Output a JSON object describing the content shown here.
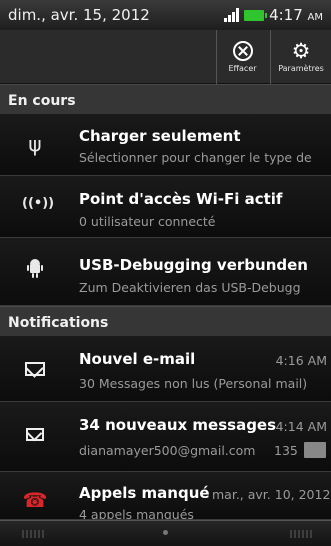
{
  "status_bar": {
    "date": "dim., avr. 15, 2012",
    "time": "4:17",
    "ampm": "AM"
  },
  "toolbar": {
    "clear_label": "Effacer",
    "settings_label": "Paramètres"
  },
  "sections": {
    "ongoing": "En cours",
    "notifications": "Notifications"
  },
  "ongoing": [
    {
      "icon": "usb-icon",
      "title": "Charger seulement",
      "subtitle": "Sélectionner pour changer le type de"
    },
    {
      "icon": "wifi-hotspot-icon",
      "title": "Point d'accès Wi-Fi actif",
      "subtitle": "0 utilisateur connecté"
    },
    {
      "icon": "android-debug-icon",
      "title": "USB-Debugging verbunden",
      "subtitle": "Zum Deaktivieren das USB-Debugg"
    }
  ],
  "notifications": [
    {
      "icon": "email-icon",
      "title": "Nouvel e-mail",
      "time": "4:16 AM",
      "subtitle": "30 Messages non lus (Personal mail)"
    },
    {
      "icon": "gmail-icon",
      "title": "34 nouveaux messages",
      "time": "4:14 AM",
      "subtitle": "dianamayer500@gmail.com",
      "count": "135"
    },
    {
      "icon": "missed-call-icon",
      "title": "Appels manqué",
      "time": "mar., avr. 10, 2012",
      "subtitle": "4 appels manqués"
    }
  ],
  "colors": {
    "battery": "#2fc52f",
    "missed_call": "#d9262b",
    "section_bg": "#363636"
  }
}
